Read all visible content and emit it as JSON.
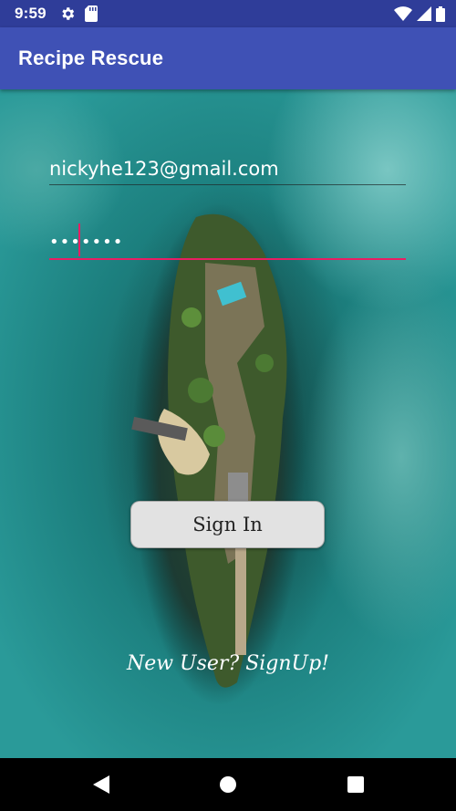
{
  "status_bar": {
    "time": "9:59"
  },
  "app_bar": {
    "title": "Recipe Rescue"
  },
  "login": {
    "email_value": "nickyhe123@gmail.com",
    "password_value": "•••••••",
    "signin_label": "Sign In",
    "signup_label": "New User? SignUp!"
  },
  "colors": {
    "status_bar": "#2f3d99",
    "app_bar": "#3f51b5",
    "accent": "#e91e63",
    "button_bg": "#e2e2e2"
  },
  "icons": [
    "settings-icon",
    "sd-card-icon",
    "wifi-icon",
    "signal-icon",
    "battery-icon",
    "back-icon",
    "home-icon",
    "recents-icon"
  ]
}
